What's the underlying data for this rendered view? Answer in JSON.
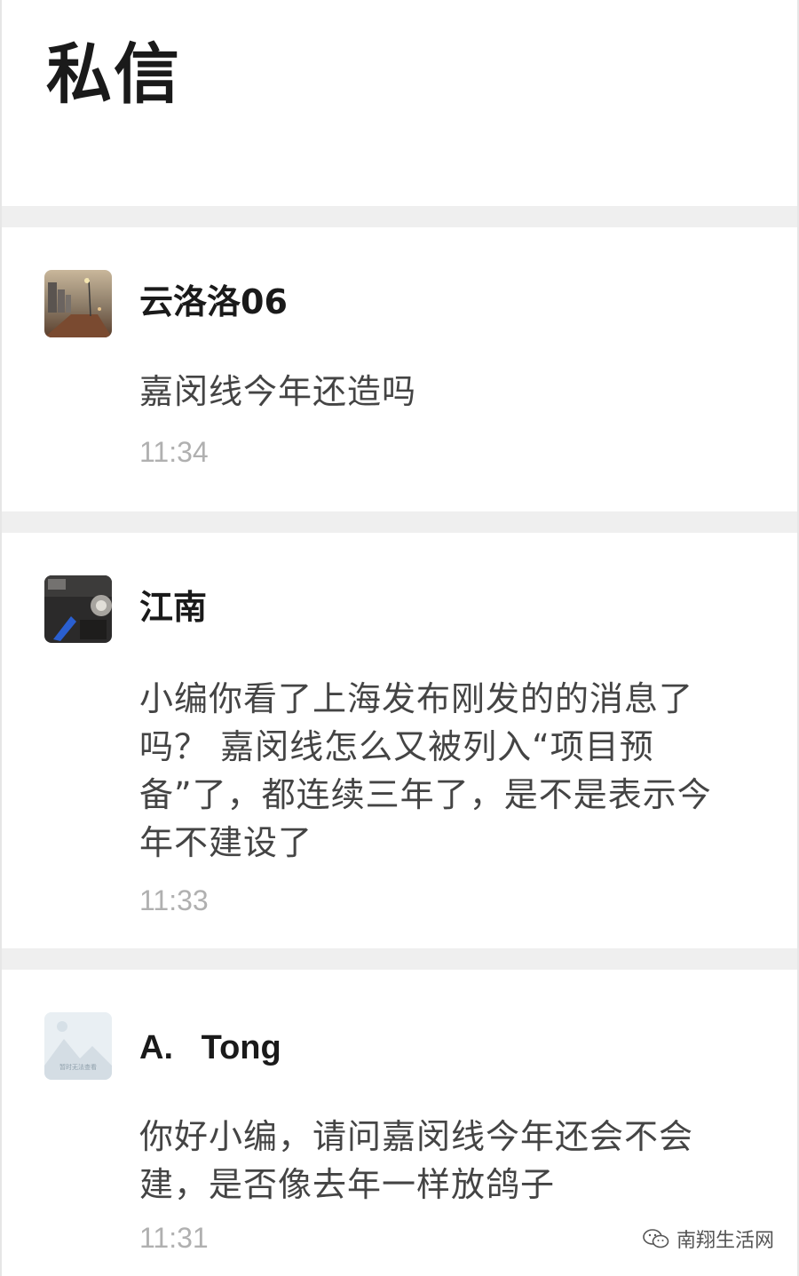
{
  "header": {
    "title": "私信"
  },
  "messages": [
    {
      "sender": "云洛洛06",
      "text": "嘉闵线今年还造吗",
      "time": "11:34",
      "avatar": "street-night-photo"
    },
    {
      "sender": "江南",
      "text": "小编你看了上海发布刚发的的消息了吗？ 嘉闵线怎么又被列入“项目预备”了，都连续三年了，是不是表示今年不建设了",
      "time": "11:33",
      "avatar": "dark-interior-photo"
    },
    {
      "sender": "A.   Tong",
      "text": "你好小编，请问嘉闵线今年还会不会建，是否像去年一样放鸽子",
      "time": "11:31",
      "avatar": "placeholder-image",
      "avatar_caption": "暂时无法查看"
    }
  ],
  "watermark": {
    "label": "南翔生活网",
    "icon": "wechat-icon"
  }
}
